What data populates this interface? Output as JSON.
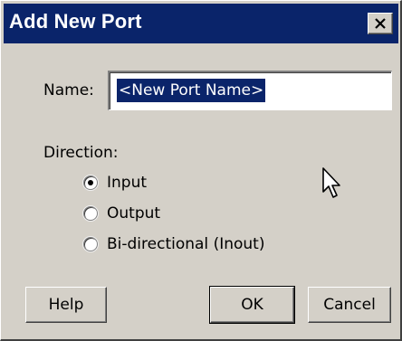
{
  "window": {
    "title": "Add New Port",
    "close_glyph": "X"
  },
  "name_field": {
    "label": "Name:",
    "value": "<New Port Name>"
  },
  "direction": {
    "label": "Direction:",
    "options": [
      {
        "label": "Input",
        "checked": true
      },
      {
        "label": "Output",
        "checked": false
      },
      {
        "label": "Bi-directional (Inout)",
        "checked": false
      }
    ]
  },
  "buttons": {
    "help": "Help",
    "ok": "OK",
    "cancel": "Cancel"
  },
  "icons": {
    "close": "close-icon",
    "cursor": "mouse-pointer-icon"
  },
  "colors": {
    "titlebar": "#0a246a",
    "dialog_face": "#d4d0c8",
    "selection": "#0a246a"
  }
}
